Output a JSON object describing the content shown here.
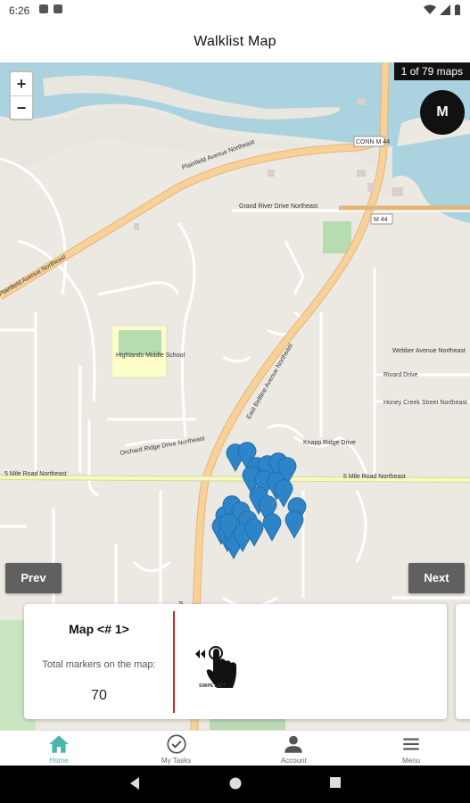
{
  "status_bar": {
    "time": "6:26"
  },
  "appbar": {
    "title": "Walklist Map"
  },
  "map": {
    "zoom_in": "+",
    "zoom_out": "−",
    "map_count": "1 of 79 maps",
    "avatar_initial": "M",
    "prev_label": "Prev",
    "next_label": "Next",
    "marker_color": "#2d84c8",
    "road_labels": {
      "plainfield": "Plainfield Avenue Northeast",
      "east_beltline": "East Beltline Avenue Northeast",
      "five_mile_w": "5 Mile Road Northeast",
      "five_mile_e": "5 Mile Road Northeast",
      "grand_river": "Grand River Drive Northeast",
      "conn_m44": "CONN M 44",
      "m44": "M 44",
      "school": "Highlands Middle School",
      "webber": "Webber Avenue Northeast",
      "rivard": "Rivard Drive",
      "honey_creek": "Honey Creek Street Northeast",
      "orchard": "Orchard Ridge Drive Northeast",
      "knapp": "Knapp Ridge Drive"
    }
  },
  "card": {
    "title": "Map <# 1>",
    "subtitle": "Total markers on the map:",
    "count": "70",
    "swipe_label": "SWIPE LEFT"
  },
  "bottom_nav": {
    "items": [
      {
        "label": "Home",
        "icon": "home-icon"
      },
      {
        "label": "My Tasks",
        "icon": "check-circle-icon"
      },
      {
        "label": "Account",
        "icon": "person-icon"
      },
      {
        "label": "Menu",
        "icon": "menu-icon"
      }
    ],
    "active_color": "#4db6ac"
  }
}
